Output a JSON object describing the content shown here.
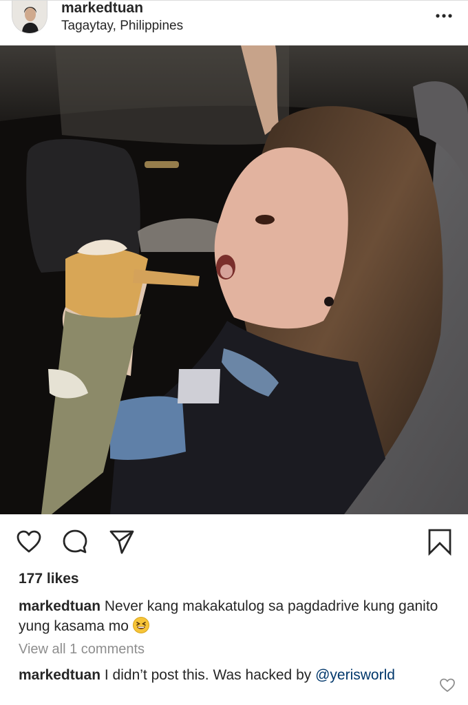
{
  "post": {
    "username": "markedtuan",
    "location": "Tagaytay, Philippines",
    "likes": "177 likes",
    "caption_user": "markedtuan",
    "caption_text": " Never kang makakatulog sa pagdadrive kung ganito yung kasama mo ",
    "view_all": "View all 1 comments",
    "comment_user": "markedtuan",
    "comment_text": " I didn’t post this. Was hacked by ",
    "comment_mention": "@yerisworld"
  },
  "icons": {
    "avatar": "profile-avatar",
    "more": "more-options-icon",
    "like": "heart-icon",
    "comment": "comment-bubble-icon",
    "share": "paper-plane-icon",
    "save": "bookmark-icon",
    "emoji": "grinning-squinting-face",
    "comment_like": "heart-outline-icon"
  },
  "colors": {
    "text": "#262626",
    "muted": "#8e8e8e",
    "mention": "#00376b"
  }
}
